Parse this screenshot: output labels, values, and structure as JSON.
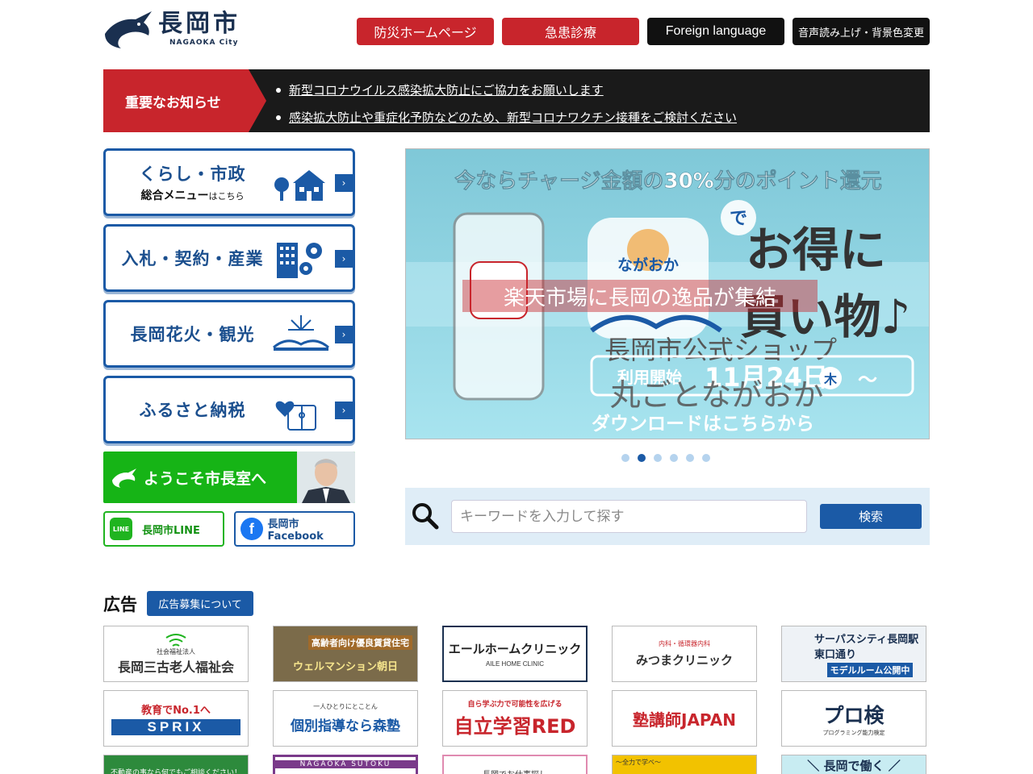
{
  "header": {
    "logo_title": "長岡市",
    "logo_sub": "NAGAOKA City",
    "buttons": {
      "bousai": "防災ホームページ",
      "kyukan": "急患診療",
      "foreign": "Foreign language",
      "onsei": "音声読み上げ・背景色変更"
    }
  },
  "notice": {
    "label": "重要なお知らせ",
    "items": [
      "新型コロナウイルス感染拡大防止にご協力をお願いします",
      "感染拡大防止や重症化予防などのため、新型コロナワクチン接種をご検討ください"
    ]
  },
  "menu": [
    {
      "main": "くらし・市政",
      "sub": "総合メニュー",
      "sub_small": "はこちら",
      "icon": "house-tree-icon"
    },
    {
      "main": "入札・契約・産業",
      "icon": "building-gear-icon"
    },
    {
      "main": "長岡花火・観光",
      "icon": "fireworks-bridge-icon"
    },
    {
      "main": "ふるさと納税",
      "icon": "heart-gift-icon"
    }
  ],
  "mayor": {
    "label": "ようこそ市長室へ"
  },
  "sns": {
    "line": "長岡市LINE",
    "line_icon_text": "LINE",
    "facebook": "長岡市Facebook"
  },
  "banner": {
    "headline": "今ならチャージ金額の30%分のポイント還元",
    "de": "で",
    "big1": "お得に",
    "big2": "買い物♪",
    "app_name": "ながおか",
    "overlay1": "楽天市場に長岡の逸品が集結",
    "overlay2": "長岡市公式ショップ",
    "overlay3": "丸ごとながおか",
    "start_label": "利用開始",
    "start_date": "11月24日",
    "start_day": "木",
    "start_tail": "～",
    "download": "ダウンロードはこちらから",
    "dots": 6,
    "active_dot": 1
  },
  "search": {
    "placeholder": "キーワードを入力して探す",
    "button": "検索"
  },
  "ads": {
    "title": "広告",
    "recruit": "広告募集について",
    "row1": [
      {
        "top": "社会福祉法人",
        "main": "長岡三古老人福祉会"
      },
      {
        "top": "高齢者向け優良賃貸住宅",
        "main": "ウェルマンション朝日"
      },
      {
        "top": "エールホームクリニック",
        "main": "AILE HOME CLINIC"
      },
      {
        "top": "内科・循環器内科",
        "main": "みつまクリニック"
      },
      {
        "top": "サーパスシティ長岡駅東口通り",
        "main": "モデルルーム公開中"
      }
    ],
    "row2": [
      {
        "top": "教育でNo.1へ",
        "main": "SPRIX"
      },
      {
        "top": "一人ひとりにとことん",
        "main": "個別指導なら森塾"
      },
      {
        "top": "自ら学ぶ力で可能性を広げる",
        "main": "自立学習RED"
      },
      {
        "top": "",
        "main": "塾講師JAPAN"
      },
      {
        "top": "プログラミング能力検定",
        "main": "プロ検"
      }
    ],
    "row3": [
      {
        "top": "不動産の事なら何でもご相談ください！"
      },
      {
        "top": "NAGAOKA SUTOKU"
      },
      {
        "top": "長岡でお仕事探し"
      },
      {
        "top": "～全力で学べ～"
      },
      {
        "top": "＼ 長岡で働く ／"
      }
    ]
  }
}
